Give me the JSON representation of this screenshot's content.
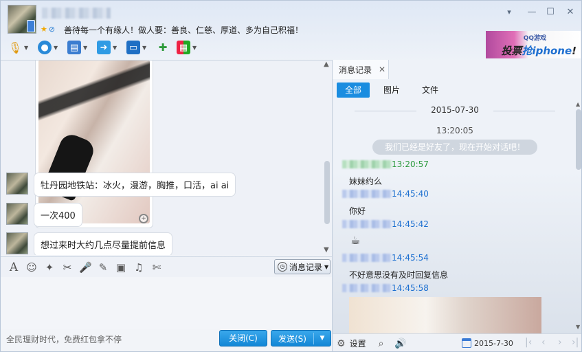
{
  "header": {
    "signature": "善待每一个有缘人！做人要：善良、仁慈、厚道、多为自己积福！",
    "minimize_glyph": "—",
    "maximize_glyph": "☐",
    "close_glyph": "✕",
    "dropdown_glyph": "▾"
  },
  "ad": {
    "game_label": "QQ游戏",
    "text_prefix": "投票",
    "text_highlight": "抢iphone",
    "text_suffix": "!"
  },
  "toolbar": {
    "icons": [
      "microphone-icon",
      "camera-icon",
      "screen-share-icon",
      "file-transfer-icon",
      "remote-desktop-icon",
      "add-chat-icon",
      "apps-icon"
    ]
  },
  "chat": {
    "messages": [
      {
        "text": "牡丹园地铁站：冰火，漫游，胸推，口活，ai ai"
      },
      {
        "text": "一次400"
      },
      {
        "text": "想过来时大约几点尽量提前信息"
      }
    ]
  },
  "input_toolbar": {
    "message_record_label": "消息记录"
  },
  "footer": {
    "promo_text": "全民理财时代，免费红包拿不停",
    "close_label": "关闭(C)",
    "send_label": "发送(S)"
  },
  "history": {
    "tab_label": "消息记录",
    "filters": [
      "全部",
      "图片",
      "文件"
    ],
    "date": "2015-07-30",
    "system_time": "13:20:05",
    "system_message": "我们已经是好友了，现在开始对话吧！",
    "records": [
      {
        "time": "13:20:57",
        "text": "妹妹约么"
      },
      {
        "time": "14:45:40",
        "text": "你好"
      },
      {
        "time": "14:45:42",
        "text": "☕"
      },
      {
        "time": "14:45:54",
        "text": "不好意思没有及时回复信息"
      },
      {
        "time": "14:45:58",
        "text": ""
      }
    ],
    "bottom": {
      "settings_label": "设置",
      "date_value": "2015-7-30"
    }
  }
}
